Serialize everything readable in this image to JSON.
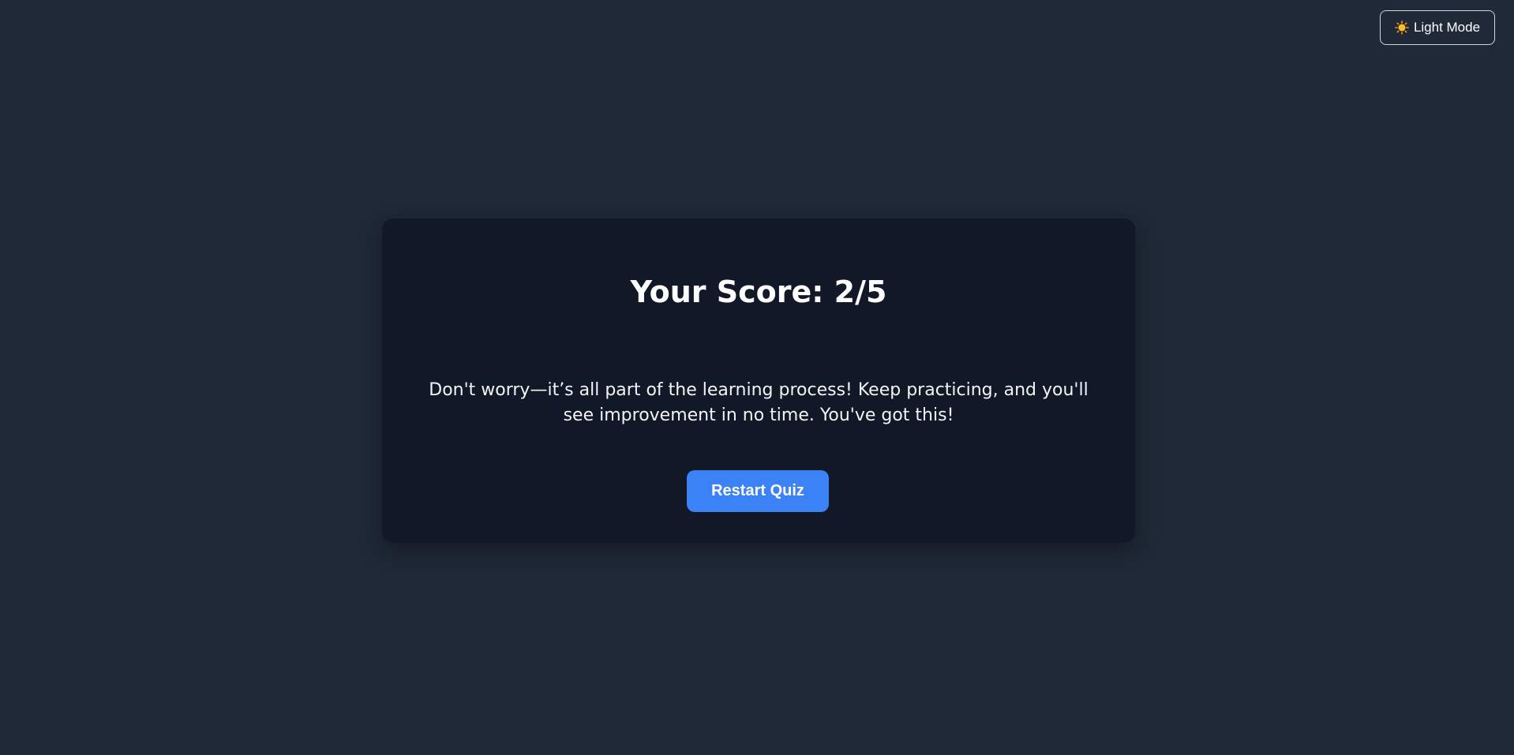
{
  "theme_toggle": {
    "label": "Light Mode",
    "icon": "sun-icon"
  },
  "result": {
    "title": "Your Score: 2/5",
    "message": "Don't worry—it’s all part of the learning process! Keep practicing, and you'll see improvement in no time. You've got this!",
    "restart_label": "Restart Quiz"
  },
  "colors": {
    "page_background": "#1f2937",
    "card_background": "#111827",
    "accent": "#3b82f6",
    "sun": "#f59e0b"
  }
}
